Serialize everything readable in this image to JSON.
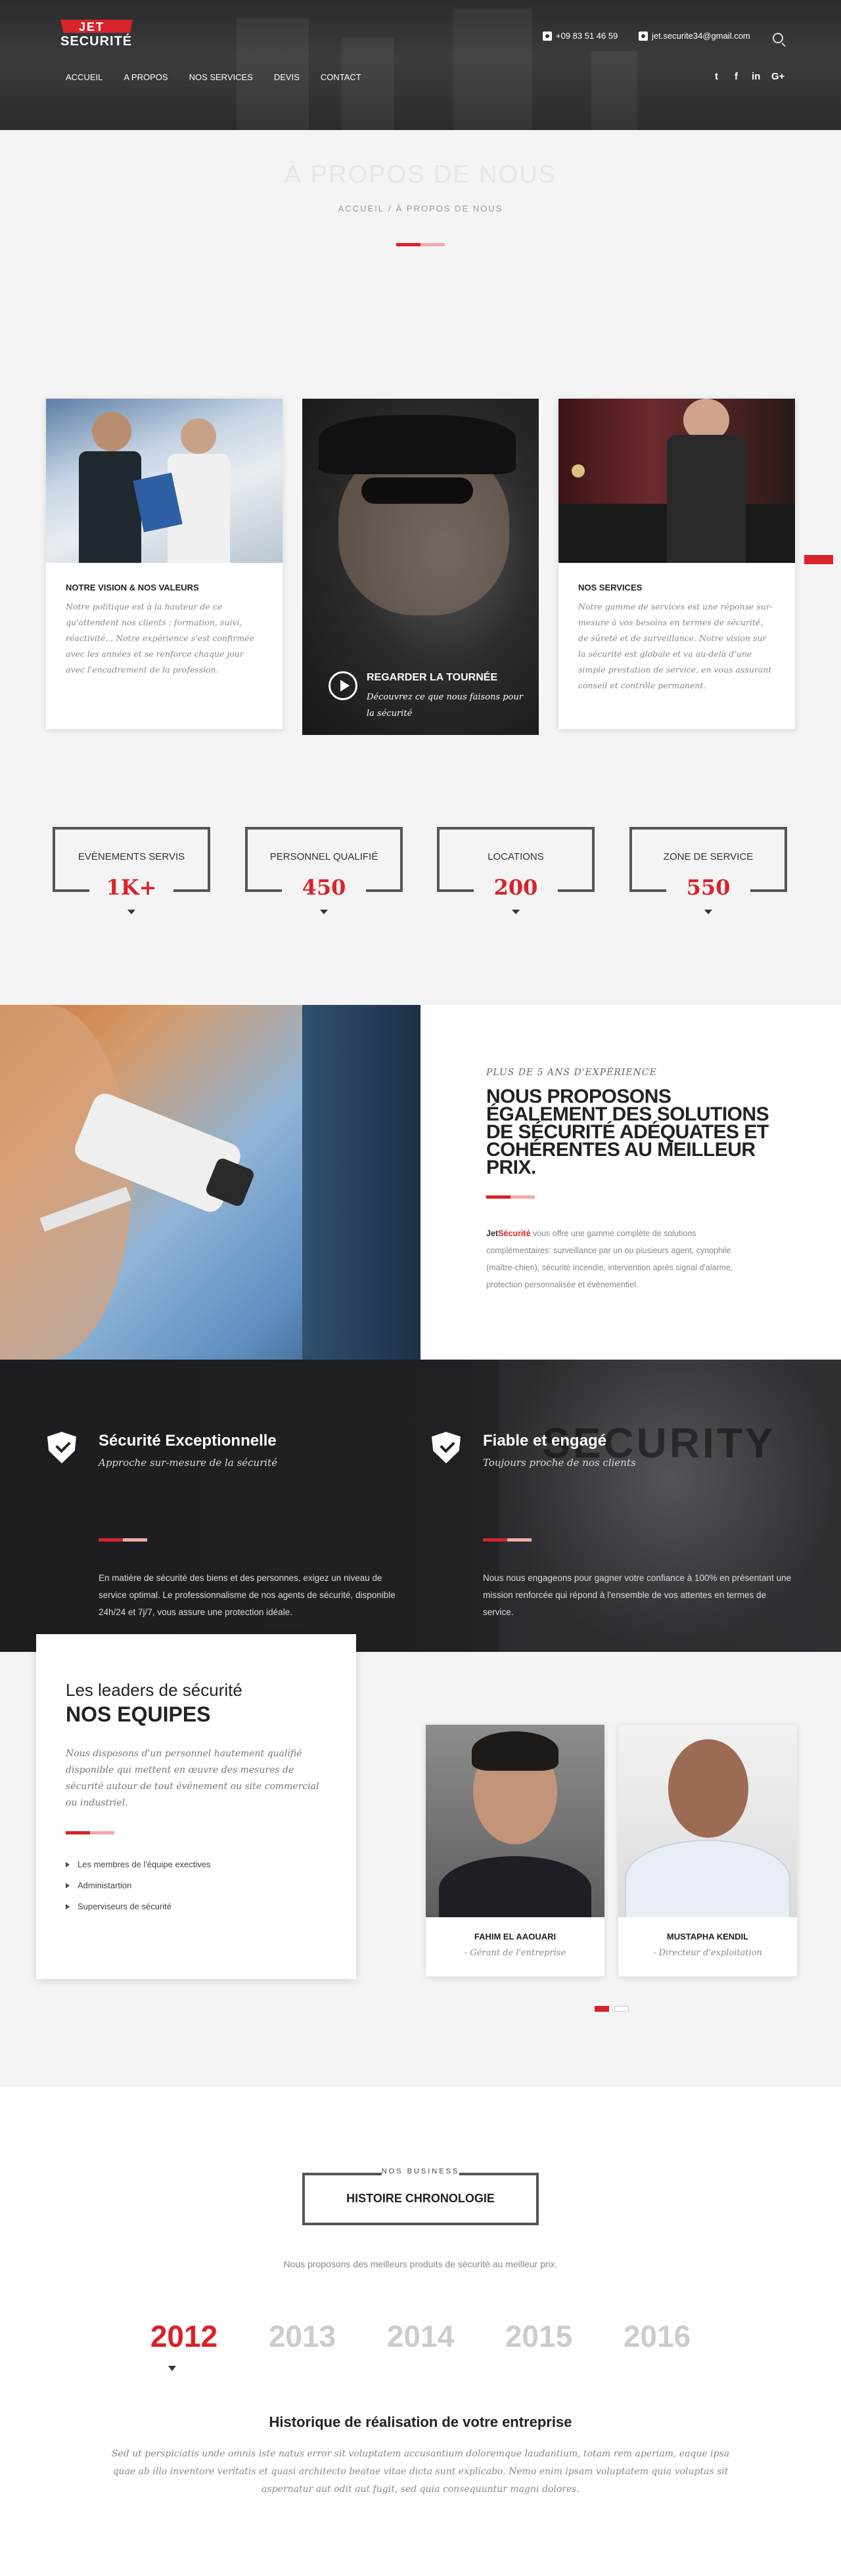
{
  "header": {
    "logo_top": "JET",
    "logo_bottom": "SECURITÉ",
    "phone": "+09 83 51 46 59",
    "email": "jet.securite34@gmail.com",
    "nav": [
      "ACCUEIL",
      "A PROPOS",
      "NOS SERVICES",
      "DEVIS",
      "CONTACT"
    ],
    "social": [
      "twitter-icon",
      "facebook-icon",
      "linkedin-icon",
      "google-plus-icon"
    ],
    "social_glyphs": [
      "t",
      "f",
      "in",
      "G+"
    ]
  },
  "page": {
    "title": "À PROPOS DE NOUS",
    "crumb_home": "ACCUEIL",
    "crumb_sep": "/",
    "crumb_current": "À PROPOS DE NOUS"
  },
  "cards": [
    {
      "title": "NOTRE VISION & NOS VALEURS",
      "text": "Notre politique est à la hauteur de ce qu'attendent nos clients : formation, suivi, réactivité... Notre expérience s'est confirmée avec les années et se renforce chaque jour avec l'encadrement de la profession."
    },
    {
      "title": "NOS SERVICES",
      "text": "Notre gamme de services est une réponse sur-mesure à vos besoins en termes de sécurité, de sûreté et de surveillance. Notre vision sur la sécurité est globale et va au-delà d'une simple prestation de service, en vous assurant conseil et contrôle permanent."
    }
  ],
  "video": {
    "title": "REGARDER LA TOURNÉE",
    "text": "Découvrez ce que nous faisons pour la sécurité"
  },
  "stats": [
    {
      "label": "EVÈNEMENTS SERVIS",
      "value": "1K+"
    },
    {
      "label": "PERSONNEL QUALIFIÉ",
      "value": "450"
    },
    {
      "label": "LOCATIONS",
      "value": "200"
    },
    {
      "label": "ZONE DE SERVICE",
      "value": "550"
    }
  ],
  "about": {
    "kicker": "PLUS DE 5 ANS D'EXPÉRIENCE",
    "heading": "NOUS PROPOSONS ÉGALEMENT DES SOLUTIONS DE SÉCURITÉ ADÉQUATES ET COHÉRENTES AU MEILLEUR PRIX.",
    "brand_a": "Jet",
    "brand_b": "Sécurité",
    "text": " vous offre une gamme complète de solutions complémentaires: surveillance par un ou plusieurs agent, cynophile (maître-chien), sécurité incendie, intervention après signal d'alarme, protection personnalisée et évènementiel."
  },
  "features": {
    "watermark": "SECURITY",
    "items": [
      {
        "title": "Sécurité Exceptionnelle",
        "tagline": "Approche sur-mesure de la sécurité",
        "text": "En matière de sécurité des biens et des personnes, exigez un niveau de service optimal. Le professionnalisme de nos agents de sécurité, disponible 24h/24 et 7j/7, vous assure une protection idéale."
      },
      {
        "title": "Fiable et engagé",
        "tagline": "Toujours proche de nos clients",
        "text": "Nous nous engageons pour gagner votre confiance à 100% en présentant une mission renforcée qui répond à l'ensemble de vos attentes en termes de service."
      }
    ]
  },
  "team": {
    "subtitle": "Les leaders de sécurité",
    "title": "NOS EQUIPES",
    "text": "Nous disposons d'un personnel hautement qualifié disponible qui mettent en œuvre des mesures de sécurité autour de tout événement ou site commercial ou industriel.",
    "list": [
      "Les membres de l'équipe exectives",
      "Administartion",
      "Superviseurs de sécurité"
    ],
    "members": [
      {
        "name": "FAHIM EL AAOUARI",
        "role": "- Gérant de l'entreprise"
      },
      {
        "name": "MUSTAPHA KENDIL",
        "role": "- Directeur d'exploitation"
      }
    ]
  },
  "history": {
    "kicker": "NOS BUSINESS",
    "title": "HISTOIRE CHRONOLOGIE",
    "lead": "Nous proposons des meilleurs produits de sécurité au meilleur prix.",
    "years": [
      "2012",
      "2013",
      "2014",
      "2015",
      "2016"
    ],
    "active_year": "2012",
    "heading": "Historique de réalisation de votre entreprise",
    "text": "Sed ut perspiciatis unde omnis iste natus error sit voluptatem accusantium doloremque laudantium, totam rem aperiam, eaque ipsa quae ab illo inventore veritatis et quasi architecto beatae vitae dicta sunt explicabo. Nemo enim ipsam voluptatem quia voluptas sit aspernatur aut odit aut fugit, sed quia consequuntur magni dolores."
  },
  "colors": {
    "accent": "#d8232a",
    "dark": "#202125"
  }
}
